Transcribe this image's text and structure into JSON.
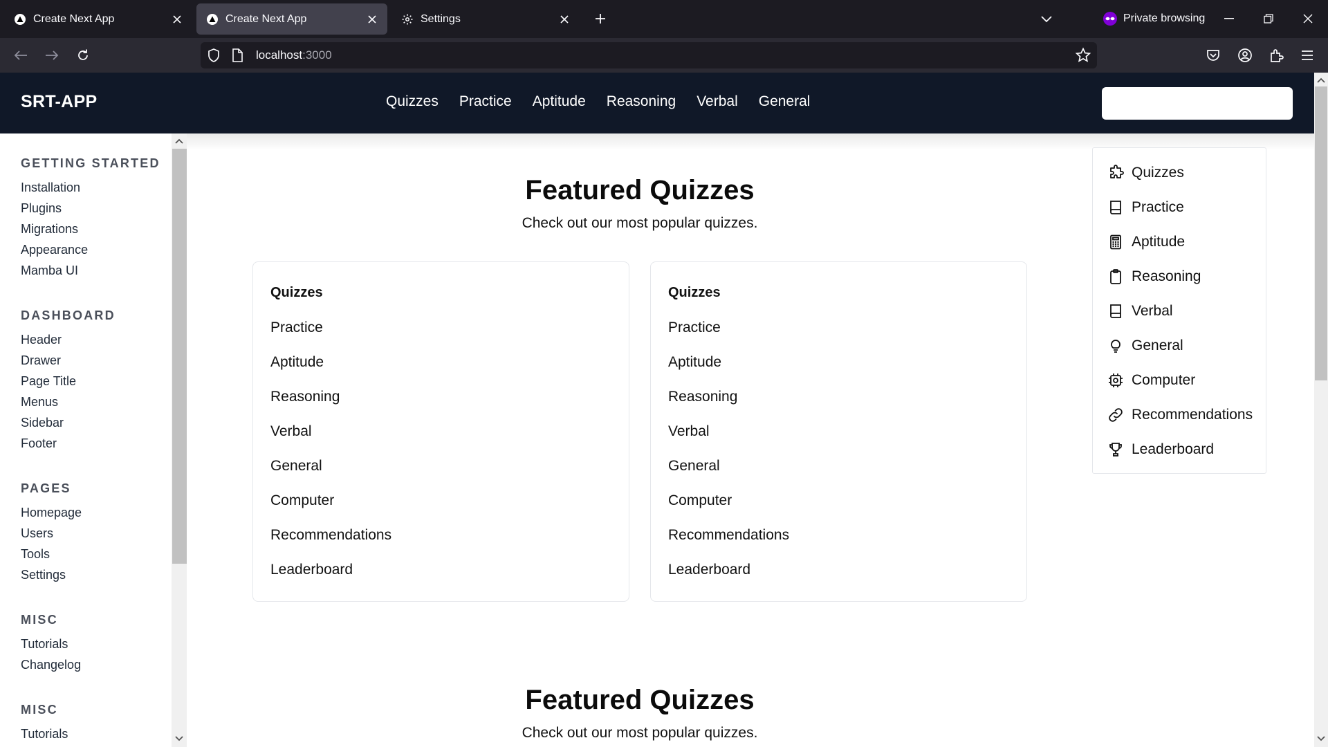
{
  "browser": {
    "tabs": [
      {
        "title": "Create Next App",
        "active": false
      },
      {
        "title": "Create Next App",
        "active": true
      },
      {
        "title": "Settings",
        "active": false
      }
    ],
    "private_label": "Private browsing",
    "url_host": "localhost",
    "url_port": ":3000"
  },
  "app": {
    "brand": "SRT-APP",
    "topnav": [
      "Quizzes",
      "Practice",
      "Aptitude",
      "Reasoning",
      "Verbal",
      "General"
    ],
    "search_placeholder": ""
  },
  "sidebar": {
    "sections": [
      {
        "title": "GETTING STARTED",
        "items": [
          "Installation",
          "Plugins",
          "Migrations",
          "Appearance",
          "Mamba UI"
        ]
      },
      {
        "title": "DASHBOARD",
        "items": [
          "Header",
          "Drawer",
          "Page Title",
          "Menus",
          "Sidebar",
          "Footer"
        ]
      },
      {
        "title": "PAGES",
        "items": [
          "Homepage",
          "Users",
          "Tools",
          "Settings"
        ]
      },
      {
        "title": "MISC",
        "items": [
          "Tutorials",
          "Changelog"
        ]
      },
      {
        "title": "MISC",
        "items": [
          "Tutorials"
        ]
      }
    ]
  },
  "featured": {
    "title": "Featured Quizzes",
    "subtitle": "Check out our most popular quizzes.",
    "card_items": [
      "Quizzes",
      "Practice",
      "Aptitude",
      "Reasoning",
      "Verbal",
      "General",
      "Computer",
      "Recommendations",
      "Leaderboard"
    ]
  },
  "featured2": {
    "title": "Featured Quizzes",
    "subtitle": "Check out our most popular quizzes."
  },
  "right_menu": {
    "items": [
      {
        "label": "Quizzes",
        "icon": "puzzle-icon"
      },
      {
        "label": "Practice",
        "icon": "book-icon"
      },
      {
        "label": "Aptitude",
        "icon": "calculator-icon"
      },
      {
        "label": "Reasoning",
        "icon": "clipboard-icon"
      },
      {
        "label": "Verbal",
        "icon": "book-icon"
      },
      {
        "label": "General",
        "icon": "lightbulb-icon"
      },
      {
        "label": "Computer",
        "icon": "cpu-icon"
      },
      {
        "label": "Recommendations",
        "icon": "link-icon"
      },
      {
        "label": "Leaderboard",
        "icon": "trophy-icon"
      }
    ]
  },
  "colors": {
    "tabbar_bg": "#1c1b22",
    "navbar_bg": "#2b2a33",
    "app_header_bg": "#101828",
    "private_purple": "#8000d7"
  }
}
